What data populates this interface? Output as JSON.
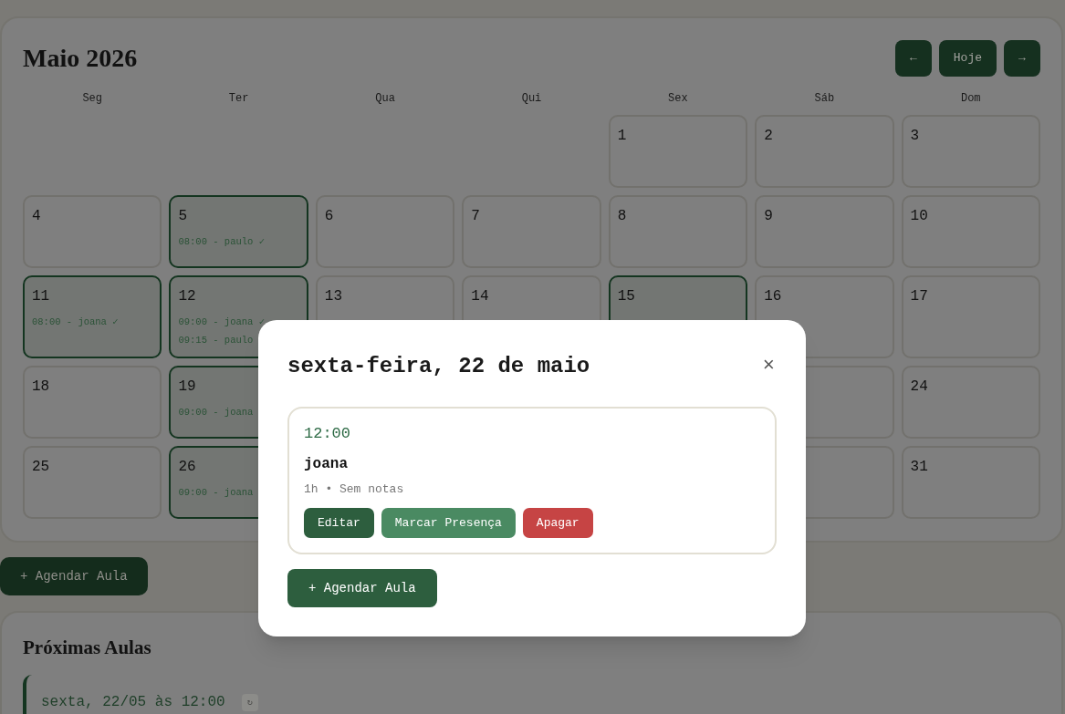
{
  "calendar": {
    "title": "Maio 2026",
    "nav_buttons": [
      {
        "kind": "prev",
        "label": "←"
      },
      {
        "kind": "today",
        "label": "Hoje"
      },
      {
        "kind": "next",
        "label": "→"
      }
    ],
    "weekdays": [
      "Seg",
      "Ter",
      "Qua",
      "Qui",
      "Sex",
      "Sáb",
      "Dom"
    ],
    "weeks": [
      [
        {
          "kind": "blank"
        },
        {
          "kind": "blank"
        },
        {
          "kind": "blank"
        },
        {
          "kind": "blank"
        },
        {
          "kind": "day",
          "number": "1",
          "highlighted": false
        },
        {
          "kind": "day",
          "number": "2",
          "highlighted": false
        },
        {
          "kind": "day",
          "number": "3",
          "highlighted": false
        }
      ],
      [
        {
          "kind": "day",
          "number": "4",
          "highlighted": false
        },
        {
          "kind": "day",
          "number": "5",
          "highlighted": true,
          "lessons": [
            "08:00 - paulo ✓"
          ]
        },
        {
          "kind": "day",
          "number": "6",
          "highlighted": false
        },
        {
          "kind": "day",
          "number": "7",
          "highlighted": false
        },
        {
          "kind": "day",
          "number": "8",
          "highlighted": false
        },
        {
          "kind": "day",
          "number": "9",
          "highlighted": false
        },
        {
          "kind": "day",
          "number": "10",
          "highlighted": false
        }
      ],
      [
        {
          "kind": "day",
          "number": "11",
          "highlighted": true,
          "lessons": [
            "08:00 - joana ✓"
          ]
        },
        {
          "kind": "day",
          "number": "12",
          "highlighted": true,
          "lessons": [
            "09:00 - joana ✓",
            "09:15 - paulo"
          ]
        },
        {
          "kind": "day",
          "number": "13",
          "highlighted": false
        },
        {
          "kind": "day",
          "number": "14",
          "highlighted": false
        },
        {
          "kind": "day",
          "number": "15",
          "highlighted": true
        },
        {
          "kind": "day",
          "number": "16",
          "highlighted": false
        },
        {
          "kind": "day",
          "number": "17",
          "highlighted": false
        }
      ],
      [
        {
          "kind": "day",
          "number": "18",
          "highlighted": false
        },
        {
          "kind": "day",
          "number": "19",
          "highlighted": true,
          "lessons": [
            "09:00 - joana"
          ]
        },
        {
          "kind": "covered"
        },
        {
          "kind": "covered"
        },
        {
          "kind": "covered"
        },
        {
          "kind": "covered"
        },
        {
          "kind": "day",
          "number": "24",
          "highlighted": false
        }
      ],
      [
        {
          "kind": "day",
          "number": "25",
          "highlighted": false
        },
        {
          "kind": "day",
          "number": "26",
          "highlighted": true,
          "lessons": [
            "09:00 - joana"
          ]
        },
        {
          "kind": "covered"
        },
        {
          "kind": "covered"
        },
        {
          "kind": "covered"
        },
        {
          "kind": "covered"
        },
        {
          "kind": "day",
          "number": "31",
          "highlighted": false
        }
      ]
    ]
  },
  "schedule_button": "+ Agendar Aula",
  "upcoming": {
    "title": "Próximas Aulas",
    "items": [
      {
        "text": "sexta, 22/05 às 12:00",
        "badge": "↻"
      }
    ]
  },
  "modal": {
    "title": "sexta-feira, 22 de maio",
    "close": "×",
    "lessons": [
      {
        "time": "12:00",
        "student": "joana",
        "details": "1h • Sem notas",
        "actions": [
          {
            "kind": "edit",
            "label": "Editar"
          },
          {
            "kind": "attendance",
            "label": "Marcar Presença"
          },
          {
            "kind": "delete",
            "label": "Apagar"
          }
        ]
      }
    ],
    "add_button": "+ Agendar Aula"
  }
}
